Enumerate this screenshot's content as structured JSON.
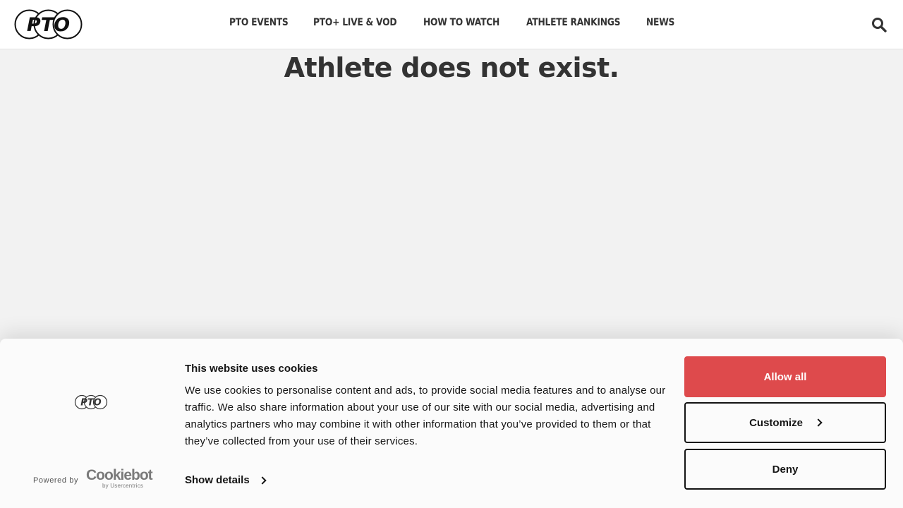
{
  "header": {
    "logo_text": "PTO",
    "nav": [
      {
        "label": "PTO EVENTS"
      },
      {
        "label": "PTO+ LIVE & VOD"
      },
      {
        "label": "HOW TO WATCH"
      },
      {
        "label": "ATHLETE RANKINGS"
      },
      {
        "label": "NEWS"
      }
    ],
    "search_icon": "search-icon"
  },
  "main": {
    "title": "Athlete does not exist."
  },
  "cookie_banner": {
    "logo_text": "PTO",
    "powered_by": "Powered by",
    "cookiebot": "Cookiebot",
    "by_usercentrics": "by Usercentrics",
    "title": "This website uses cookies",
    "text": "We use cookies to personalise content and ads, to provide social media features and to analyse our traffic. We also share information about your use of our site with our social media, advertising and analytics partners who may combine it with other information that you’ve provided to them or that they’ve collected from your use of their services.",
    "show_details": "Show details",
    "allow_all": "Allow all",
    "customize": "Customize",
    "deny": "Deny"
  },
  "colors": {
    "accent": "#de4a4c",
    "text": "#141414",
    "heading": "#333333",
    "background": "#f2f2f2"
  }
}
